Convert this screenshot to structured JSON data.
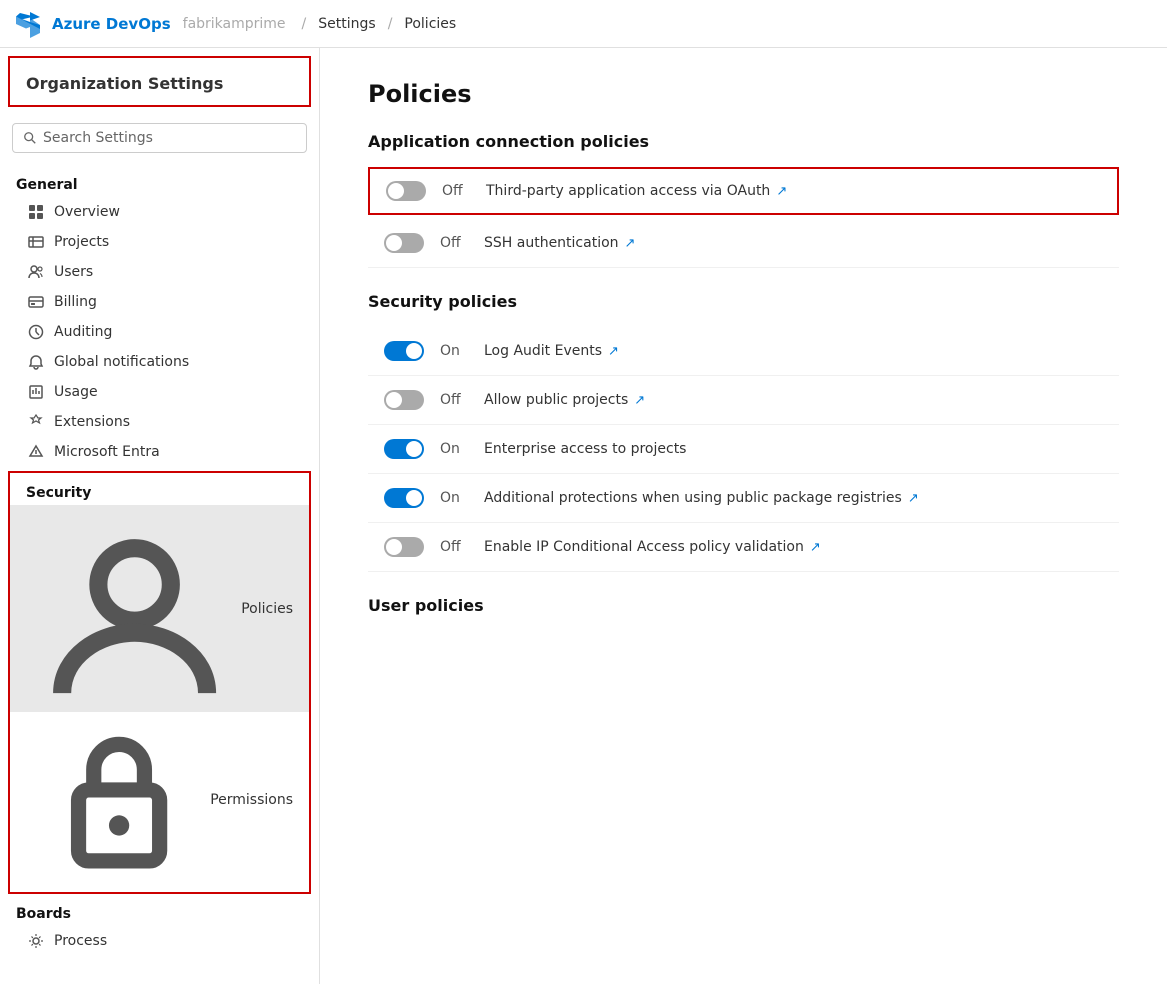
{
  "nav": {
    "brand": "Azure DevOps",
    "org": "fabrikamprime",
    "sep1": "/",
    "settings": "Settings",
    "sep2": "/",
    "current": "Policies"
  },
  "sidebar": {
    "title": "Organization Settings",
    "search_placeholder": "Search Settings",
    "general": {
      "heading": "General",
      "items": [
        {
          "id": "overview",
          "label": "Overview",
          "icon": "grid"
        },
        {
          "id": "projects",
          "label": "Projects",
          "icon": "project"
        },
        {
          "id": "users",
          "label": "Users",
          "icon": "users"
        },
        {
          "id": "billing",
          "label": "Billing",
          "icon": "billing"
        },
        {
          "id": "auditing",
          "label": "Auditing",
          "icon": "auditing"
        },
        {
          "id": "global-notifications",
          "label": "Global notifications",
          "icon": "bell"
        },
        {
          "id": "usage",
          "label": "Usage",
          "icon": "usage"
        },
        {
          "id": "extensions",
          "label": "Extensions",
          "icon": "extensions"
        },
        {
          "id": "microsoft-entra",
          "label": "Microsoft Entra",
          "icon": "entra"
        }
      ]
    },
    "security": {
      "heading": "Security",
      "items": [
        {
          "id": "policies",
          "label": "Policies",
          "icon": "policies",
          "active": true
        },
        {
          "id": "permissions",
          "label": "Permissions",
          "icon": "permissions"
        }
      ]
    },
    "boards": {
      "heading": "Boards",
      "items": [
        {
          "id": "process",
          "label": "Process",
          "icon": "process"
        }
      ]
    }
  },
  "main": {
    "title": "Policies",
    "sections": [
      {
        "id": "app-connection",
        "heading": "Application connection policies",
        "policies": [
          {
            "id": "oauth",
            "state": "off",
            "label": "Off",
            "name": "Third-party application access via OAuth",
            "link": true,
            "highlighted": true
          },
          {
            "id": "ssh",
            "state": "off",
            "label": "Off",
            "name": "SSH authentication",
            "link": true,
            "highlighted": false
          }
        ]
      },
      {
        "id": "security-policies",
        "heading": "Security policies",
        "policies": [
          {
            "id": "log-audit",
            "state": "on",
            "label": "On",
            "name": "Log Audit Events",
            "link": true,
            "highlighted": false
          },
          {
            "id": "public-projects",
            "state": "off",
            "label": "Off",
            "name": "Allow public projects",
            "link": true,
            "highlighted": false
          },
          {
            "id": "enterprise-access",
            "state": "on",
            "label": "On",
            "name": "Enterprise access to projects",
            "link": false,
            "highlighted": false
          },
          {
            "id": "additional-protections",
            "state": "on",
            "label": "On",
            "name": "Additional protections when using public package registries",
            "link": true,
            "highlighted": false
          },
          {
            "id": "ip-conditional",
            "state": "off",
            "label": "Off",
            "name": "Enable IP Conditional Access policy validation",
            "link": true,
            "highlighted": false
          }
        ]
      },
      {
        "id": "user-policies",
        "heading": "User policies",
        "policies": []
      }
    ]
  }
}
